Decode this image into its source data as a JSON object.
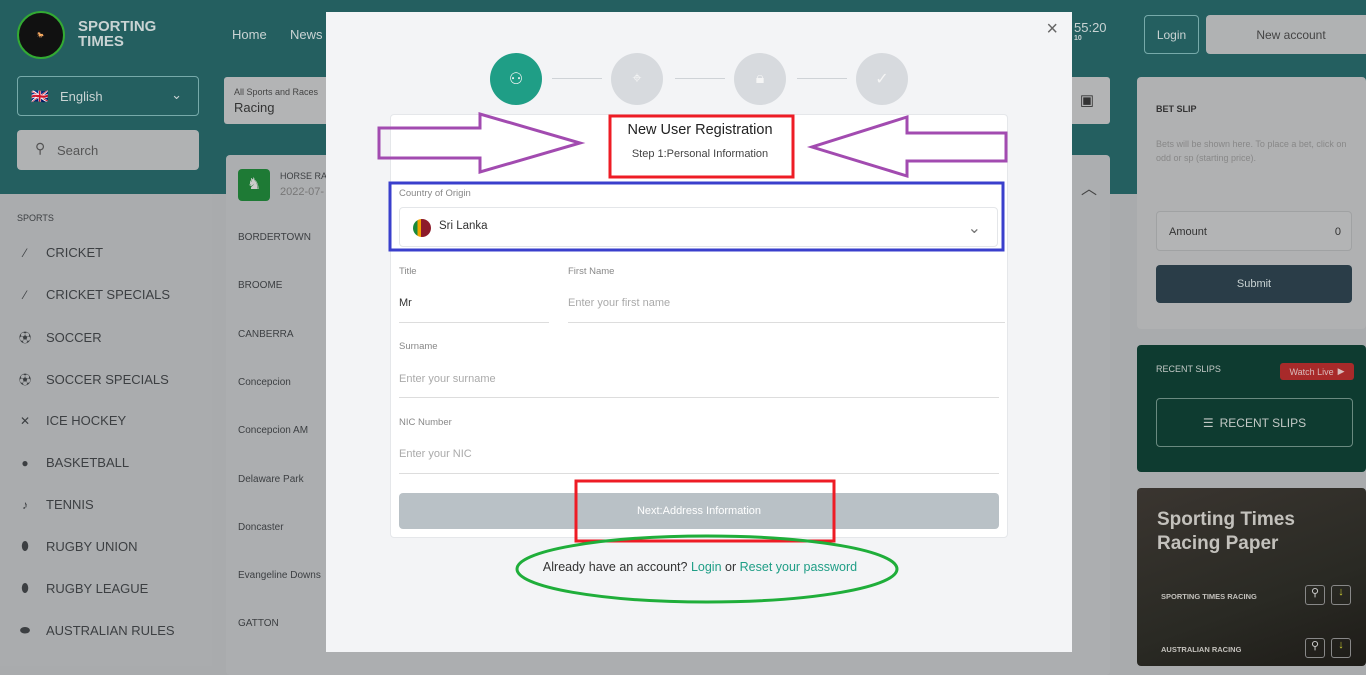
{
  "header": {
    "brand": "SPORTING TIMES",
    "logo_text": "SPORTING TIMES TURF ACCOUNTANTS",
    "nav": [
      "Home",
      "News"
    ],
    "clock": "55:20",
    "clock_sub": "10",
    "login": "Login",
    "new_account": "New account"
  },
  "sidebar": {
    "language": "English",
    "search": "Search",
    "sports_heading": "SPORTS",
    "sports": [
      {
        "label": "CRICKET",
        "icon": "cricket-bat-icon"
      },
      {
        "label": "CRICKET SPECIALS",
        "icon": "cricket-bat-icon"
      },
      {
        "label": "SOCCER",
        "icon": "soccer-ball-icon"
      },
      {
        "label": "SOCCER SPECIALS",
        "icon": "soccer-ball-icon"
      },
      {
        "label": "ICE HOCKEY",
        "icon": "hockey-sticks-icon"
      },
      {
        "label": "BASKETBALL",
        "icon": "basketball-icon"
      },
      {
        "label": "TENNIS",
        "icon": "tennis-racket-icon"
      },
      {
        "label": "RUGBY UNION",
        "icon": "rugby-ball-icon"
      },
      {
        "label": "RUGBY LEAGUE",
        "icon": "rugby-ball-icon"
      },
      {
        "label": "AUSTRALIAN RULES",
        "icon": "football-icon"
      }
    ]
  },
  "filter": {
    "label": "All Sports and Races",
    "value": "Racing"
  },
  "races": {
    "title": "HORSE RA",
    "date": "2022-07-",
    "venues": [
      "BORDERTOWN",
      "BROOME",
      "CANBERRA",
      "Concepcion",
      "Concepcion AM",
      "Delaware Park",
      "Doncaster",
      "Evangeline Downs",
      "GATTON"
    ]
  },
  "betslip": {
    "title": "BET SLIP",
    "note": "Bets will be shown here. To place a bet, click on odd or sp (starting price).",
    "amount_label": "Amount",
    "amount_value": "0",
    "submit": "Submit"
  },
  "recent": {
    "title": "RECENT SLIPS",
    "watch_live": "Watch Live",
    "button": "RECENT SLIPS"
  },
  "paper": {
    "title": "Sporting Times Racing Paper",
    "items": [
      "SPORTING TIMES RACING",
      "AUSTRALIAN RACING"
    ]
  },
  "modal": {
    "steps": [
      {
        "icon": "user-icon",
        "active": true
      },
      {
        "icon": "location-pin-icon",
        "active": false
      },
      {
        "icon": "lock-icon",
        "active": false
      },
      {
        "icon": "check-circle-icon",
        "active": false
      }
    ],
    "title": "New User Registration",
    "subtitle": "Step 1:Personal Information",
    "country_label": "Country of Origin",
    "country_value": "Sri Lanka",
    "title_label": "Title",
    "title_value": "Mr",
    "first_name_label": "First Name",
    "first_name_placeholder": "Enter your first name",
    "surname_label": "Surname",
    "surname_placeholder": "Enter your surname",
    "nic_label": "NIC Number",
    "nic_placeholder": "Enter your NIC",
    "next_button": "Next:Address Information",
    "footer_prefix": "Already have an account?",
    "footer_login": "Login",
    "footer_or": "or",
    "footer_reset": "Reset your password"
  },
  "colors": {
    "accent": "#1f9e86",
    "link": "#1f9e86",
    "annotation_red": "#ee1c25",
    "annotation_blue": "#3a3fcc",
    "annotation_purple": "#a24bb0",
    "annotation_green": "#1fae3a"
  }
}
